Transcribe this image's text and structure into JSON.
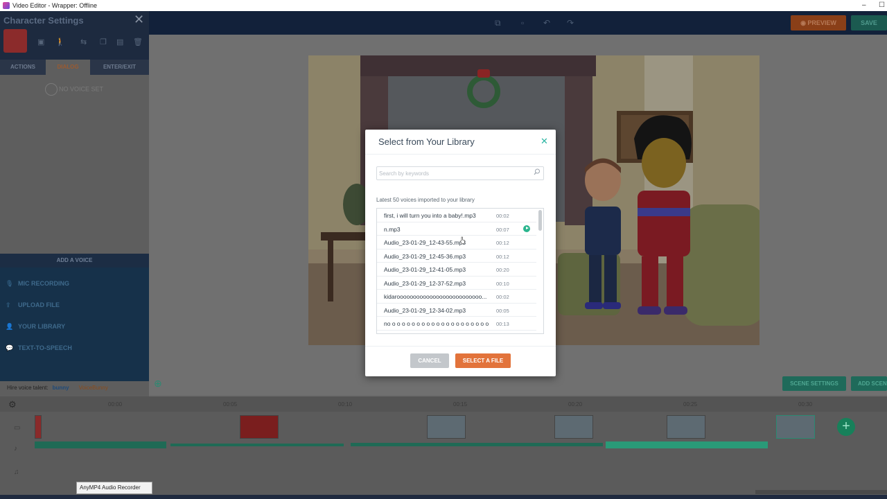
{
  "window": {
    "title": "Video Editor - Wrapper: Offline",
    "minimize": "–",
    "maximize": "☐"
  },
  "topbar": {
    "preview_label": "PREVIEW",
    "save_label": "SAVE"
  },
  "left_panel": {
    "title": "Character Settings",
    "close": "✕",
    "tabs": [
      {
        "label": "ACTIONS"
      },
      {
        "label": "DIALOG"
      },
      {
        "label": "ENTER/EXIT"
      }
    ],
    "active_tab": "DIALOG",
    "no_voice": "NO VOICE SET",
    "add_voice_title": "ADD A VOICE",
    "add_voice_items": [
      {
        "label": "MIC RECORDING",
        "icon": "mic-icon"
      },
      {
        "label": "UPLOAD FILE",
        "icon": "upload-icon"
      },
      {
        "label": "YOUR LIBRARY",
        "icon": "user-icon"
      },
      {
        "label": "TEXT-TO-SPEECH",
        "icon": "chat-icon"
      }
    ],
    "hire_label": "Hire voice talent:",
    "hire_brand1": "bunny",
    "hire_brand2": "VoiceBunny"
  },
  "canvas": {
    "scene_settings": "SCENE SETTINGS",
    "add_scene": "ADD SCENE"
  },
  "timeline": {
    "ticks": [
      "00:00",
      "00:05",
      "00:10",
      "00:15",
      "00:20",
      "00:25",
      "00:30"
    ]
  },
  "modal": {
    "title": "Select from Your Library",
    "close": "✕",
    "search_placeholder": "Search by keywords",
    "caption": "Latest 50 voices imported to your library",
    "items": [
      {
        "name": "first, i will turn you into a baby!.mp3",
        "duration": "00:02"
      },
      {
        "name": "n.mp3",
        "duration": "00:07"
      },
      {
        "name": "Audio_23-01-29_12-43-55.mp3",
        "duration": "00:12"
      },
      {
        "name": "Audio_23-01-29_12-45-36.mp3",
        "duration": "00:12"
      },
      {
        "name": "Audio_23-01-29_12-41-05.mp3",
        "duration": "00:20"
      },
      {
        "name": "Audio_23-01-29_12-37-52.mp3",
        "duration": "00:10"
      },
      {
        "name": "kidaroooooooooooooooooooooooooo...",
        "duration": "00:02"
      },
      {
        "name": "Audio_23-01-29_12-34-02.mp3",
        "duration": "00:05"
      },
      {
        "name": "no o o o o o o o o o o o o o o o o o o o o o o...",
        "duration": "00:13"
      }
    ],
    "cancel_label": "CANCEL",
    "select_label": "SELECT A FILE"
  },
  "taskbar_tooltip": "AnyMP4 Audio Recorder",
  "colors": {
    "accent": "#2bb5a2",
    "primary_button": "#e2733b",
    "panel_dark": "#16314a"
  }
}
